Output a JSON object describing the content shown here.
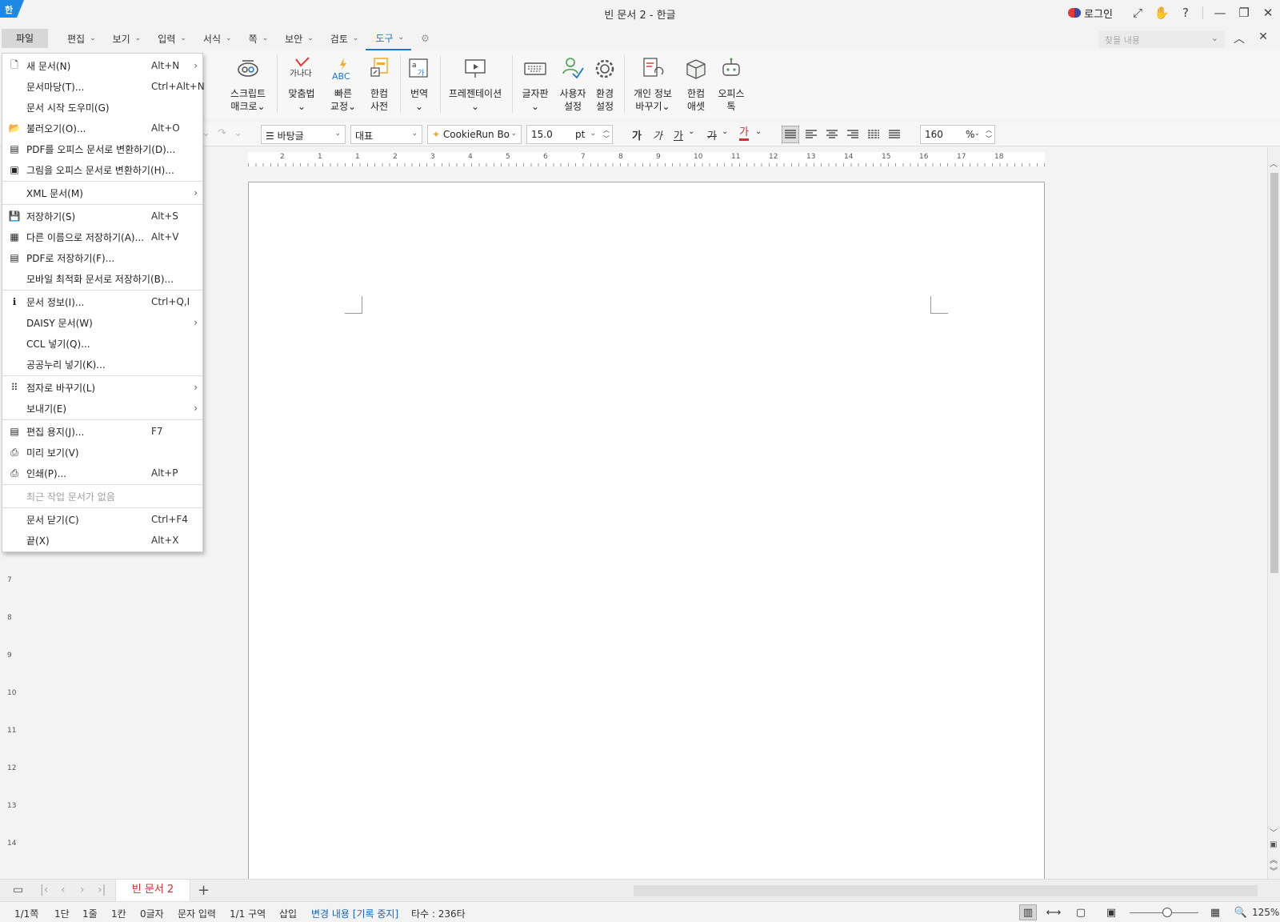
{
  "titlebar": {
    "logo": "한",
    "title": "빈 문서 2 - 한글",
    "login": "로그인",
    "icons": [
      "expand-icon",
      "hand-icon",
      "help-icon",
      "minimize-icon",
      "restore-icon",
      "close-icon"
    ]
  },
  "menubar": {
    "file": "파일",
    "items": [
      "편집",
      "보기",
      "입력",
      "서식",
      "쪽",
      "보안",
      "검토",
      "도구"
    ],
    "active": "도구",
    "find_placeholder": "찾을 내용"
  },
  "ribbon": {
    "buttons": [
      {
        "line1": "스크립트",
        "line2": "매크로"
      },
      {
        "line1": "맞춤법",
        "line2": ""
      },
      {
        "line1": "빠른",
        "line2": "교정"
      },
      {
        "line1": "한컴",
        "line2": "사전"
      },
      {
        "line1": "번역",
        "line2": ""
      },
      {
        "line1": "프레젠테이션",
        "line2": ""
      },
      {
        "line1": "글자판",
        "line2": ""
      },
      {
        "line1": "사용자",
        "line2": "설정"
      },
      {
        "line1": "환경",
        "line2": "설정"
      },
      {
        "line1": "개인 정보",
        "line2": "바꾸기"
      },
      {
        "line1": "한컴",
        "line2": "애셋"
      },
      {
        "line1": "오피스",
        "line2": "톡"
      }
    ],
    "spell_icon_text": "가나다",
    "quick_icon_text": "ABC"
  },
  "format": {
    "style": "바탕글",
    "lang": "대표",
    "font": "CookieRun Bo",
    "size": "15.0",
    "unit": "pt",
    "bold": "가",
    "italic": "가",
    "underline": "가",
    "strike": "가",
    "color": "가",
    "line_spacing": "160",
    "line_unit": "%"
  },
  "ruler": {
    "h_labels": [
      "2",
      "1",
      "1",
      "2",
      "3",
      "4",
      "5",
      "6",
      "7",
      "8",
      "9",
      "10",
      "11",
      "12",
      "13",
      "14",
      "15",
      "16",
      "17",
      "18"
    ],
    "v_labels": [
      "7",
      "8",
      "9",
      "10",
      "11",
      "12",
      "13",
      "14"
    ]
  },
  "file_menu": {
    "groups": [
      [
        {
          "icon": "new-document-icon",
          "glyph": "🗋",
          "label": "새 문서(N)",
          "shortcut": "Alt+N",
          "submenu": true
        },
        {
          "icon": "",
          "glyph": "",
          "label": "문서마당(T)...",
          "shortcut": "Ctrl+Alt+N",
          "submenu": false
        },
        {
          "icon": "",
          "glyph": "",
          "label": "문서 시작 도우미(G)",
          "shortcut": "",
          "submenu": false
        },
        {
          "icon": "open-folder-icon",
          "glyph": "📂",
          "label": "불러오기(O)...",
          "shortcut": "Alt+O",
          "submenu": false
        },
        {
          "icon": "pdf-convert-icon",
          "glyph": "▤",
          "label": "PDF를 오피스 문서로 변환하기(D)...",
          "shortcut": "",
          "submenu": false
        },
        {
          "icon": "image-convert-icon",
          "glyph": "▣",
          "label": "그림을 오피스 문서로 변환하기(H)...",
          "shortcut": "",
          "submenu": false
        }
      ],
      [
        {
          "icon": "",
          "glyph": "",
          "label": "XML 문서(M)",
          "shortcut": "",
          "submenu": true
        }
      ],
      [
        {
          "icon": "save-icon",
          "glyph": "💾",
          "label": "저장하기(S)",
          "shortcut": "Alt+S",
          "submenu": false
        },
        {
          "icon": "save-as-icon",
          "glyph": "▦",
          "label": "다른 이름으로 저장하기(A)...",
          "shortcut": "Alt+V",
          "submenu": false
        },
        {
          "icon": "save-pdf-icon",
          "glyph": "▤",
          "label": "PDF로 저장하기(F)...",
          "shortcut": "",
          "submenu": false
        },
        {
          "icon": "",
          "glyph": "",
          "label": "모바일 최적화 문서로 저장하기(B)...",
          "shortcut": "",
          "submenu": false
        }
      ],
      [
        {
          "icon": "info-icon",
          "glyph": "ℹ",
          "label": "문서 정보(I)...",
          "shortcut": "Ctrl+Q,I",
          "submenu": false
        },
        {
          "icon": "",
          "glyph": "",
          "label": "DAISY 문서(W)",
          "shortcut": "",
          "submenu": true
        },
        {
          "icon": "",
          "glyph": "",
          "label": "CCL 넣기(Q)...",
          "shortcut": "",
          "submenu": false
        },
        {
          "icon": "",
          "glyph": "",
          "label": "공공누리 넣기(K)...",
          "shortcut": "",
          "submenu": false
        }
      ],
      [
        {
          "icon": "braille-icon",
          "glyph": "⠿",
          "label": "점자로 바꾸기(L)",
          "shortcut": "",
          "submenu": true
        },
        {
          "icon": "",
          "glyph": "",
          "label": "보내기(E)",
          "shortcut": "",
          "submenu": true
        }
      ],
      [
        {
          "icon": "page-setup-icon",
          "glyph": "▤",
          "label": "편집 용지(J)...",
          "shortcut": "F7",
          "submenu": false
        },
        {
          "icon": "preview-icon",
          "glyph": "⎙",
          "label": "미리 보기(V)",
          "shortcut": "",
          "submenu": false
        },
        {
          "icon": "print-icon",
          "glyph": "⎙",
          "label": "인쇄(P)...",
          "shortcut": "Alt+P",
          "submenu": false
        }
      ],
      [
        {
          "icon": "",
          "glyph": "",
          "label": "최근 작업 문서가 없음",
          "shortcut": "",
          "submenu": false,
          "disabled": true
        }
      ],
      [
        {
          "icon": "",
          "glyph": "",
          "label": "문서 닫기(C)",
          "shortcut": "Ctrl+F4",
          "submenu": false
        },
        {
          "icon": "",
          "glyph": "",
          "label": "끝(X)",
          "shortcut": "Alt+X",
          "submenu": false
        }
      ]
    ]
  },
  "tabs": {
    "doc_tab": "빈 문서 2",
    "add": "+"
  },
  "status": {
    "page": "1/1쪽",
    "column": "1단",
    "line": "1줄",
    "col": "1칸",
    "chars": "0글자",
    "mode": "문자 입력",
    "section": "1/1 구역",
    "insert": "삽입",
    "track": "변경 내용 [기록 중지]",
    "typing": "타수 : 236타",
    "zoom": "125%"
  },
  "colors": {
    "accent": "#1976d2",
    "tab_text": "#d32f2f",
    "track_text": "#1565c0"
  }
}
